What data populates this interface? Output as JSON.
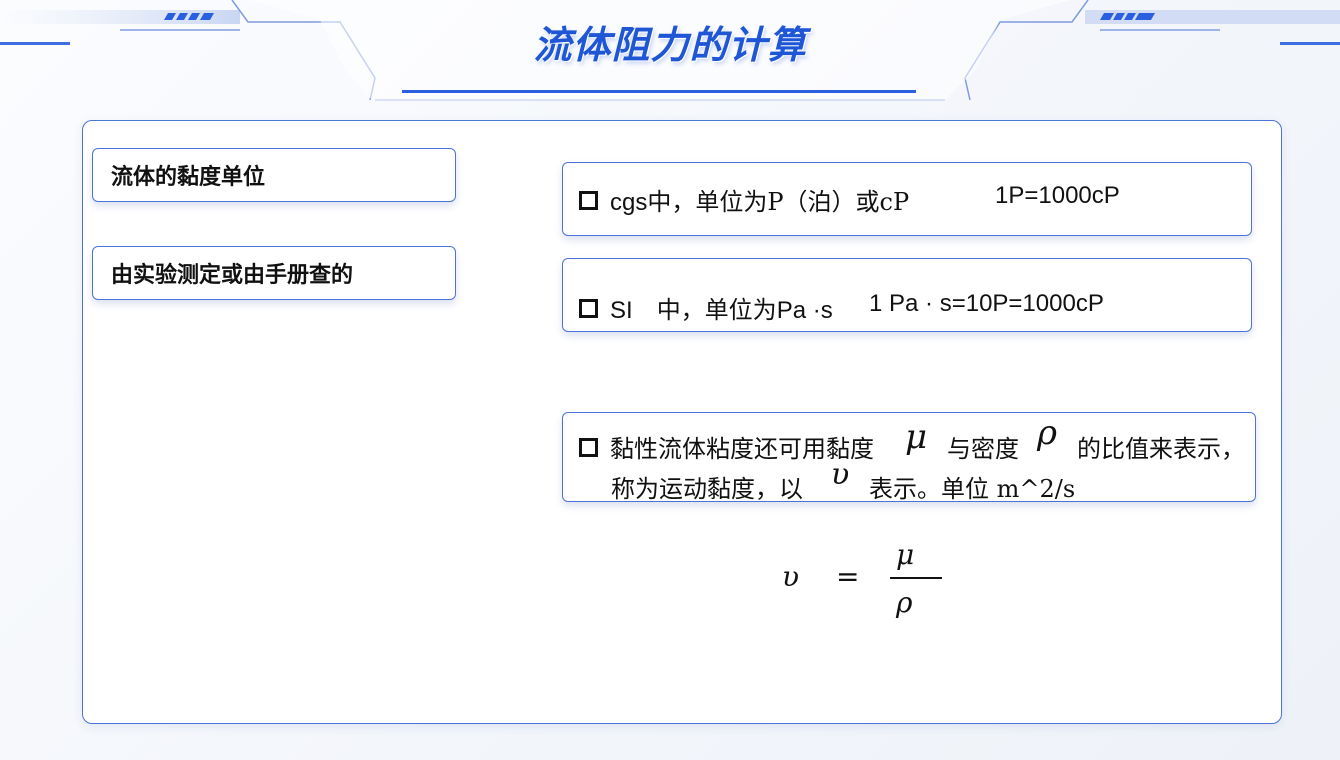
{
  "title": "流体阻力的计算",
  "labels": {
    "viscosity_unit": "流体的黏度单位",
    "source": "由实验测定或由手册查的"
  },
  "cgs": {
    "prefix": "cgs",
    "text": "中，单位为",
    "unit": "P（泊）或cP",
    "relation": "1P=1000cP"
  },
  "si": {
    "prefix": "SI",
    "text": "中，单位为",
    "unit": "Pa ·s",
    "relation": "1 Pa · s=10P=1000cP"
  },
  "kinematic": {
    "part1": "黏性流体粘度还可用黏度",
    "mu": "μ",
    "part2": "与密度",
    "rho": "ρ",
    "part3": "的比值来表示，",
    "part4": "称为运动黏度，以",
    "nu": "υ",
    "part5": "表示。单位 m^2/s"
  },
  "formula": {
    "lhs": "υ",
    "eq": "=",
    "numerator": "μ",
    "denominator": "ρ"
  },
  "colors": {
    "accent": "#1f56d6",
    "border": "#4c74d8"
  }
}
